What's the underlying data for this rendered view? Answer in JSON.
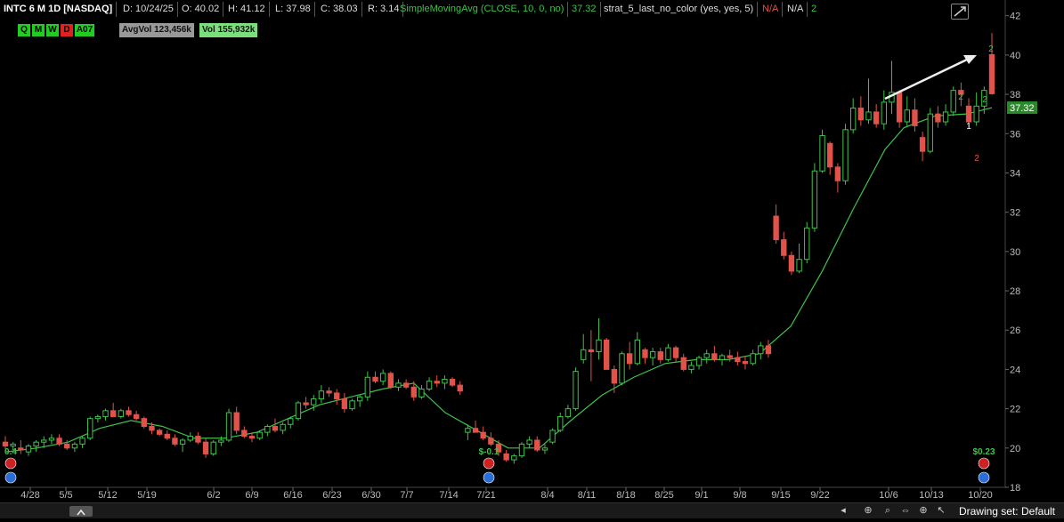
{
  "header": {
    "symbol": "INTC 6 M 1D [NASDAQ]",
    "date": "D: 10/24/25",
    "open": "O: 40.02",
    "high": "H: 41.12",
    "low": "L: 37.98",
    "close": "C: 38.03",
    "range": "R: 3.14",
    "study": "SimpleMovingAvg (CLOSE, 10, 0, no)",
    "study_value": "37.32",
    "strat": "strat_5_last_no_color (yes, yes, 5)",
    "na1": "N/A",
    "na2": "N/A",
    "count": "2"
  },
  "flags": [
    "Q",
    "M",
    "W",
    "D",
    "A07"
  ],
  "flag_colors": [
    "#22cc22",
    "#22cc22",
    "#22cc22",
    "#dd2222",
    "#22cc22"
  ],
  "avgvol": "AvgVol 123,456k",
  "vol": "Vol 155,932k",
  "price_tag": "37.32",
  "event_labels": [
    {
      "text": "$-0.1",
      "date": "7/21"
    },
    {
      "text": "$0.23",
      "date": "10/20"
    },
    {
      "text": "0.4",
      "date": "4/28"
    }
  ],
  "strat_marks": [
    {
      "text": "2",
      "color": "#3fc24a"
    },
    {
      "text": "2",
      "color": "#3fc24a"
    },
    {
      "text": "2",
      "color": "#3fc24a"
    },
    {
      "text": "1",
      "color": "#ffffff"
    },
    {
      "text": "2",
      "color": "#e0524a"
    }
  ],
  "footer": {
    "drawing_set": "Drawing set: Default"
  },
  "colors": {
    "up": "#3fc24a",
    "down": "#e0524a",
    "sma": "#3fc24a",
    "axis": "#bbbbbb"
  },
  "chart_data": {
    "type": "candlestick",
    "title": "INTC 6 M 1D [NASDAQ]",
    "x_tick_labels": [
      "4/28",
      "5/5",
      "5/12",
      "5/19",
      "6/2",
      "6/9",
      "6/16",
      "6/23",
      "6/30",
      "7/7",
      "7/14",
      "7/21",
      "8/4",
      "8/11",
      "8/18",
      "8/25",
      "9/1",
      "9/8",
      "9/15",
      "9/22",
      "10/6",
      "10/13",
      "10/20"
    ],
    "y_ticks": [
      18,
      20,
      22,
      24,
      26,
      28,
      30,
      32,
      34,
      36,
      38,
      40,
      42
    ],
    "ylim": [
      18,
      42.8
    ],
    "candles": [
      [
        20.3,
        20.6,
        19.9,
        20.1
      ],
      [
        20.1,
        20.3,
        19.9,
        20.2
      ],
      [
        20.0,
        20.4,
        19.7,
        19.9
      ],
      [
        19.8,
        20.2,
        19.6,
        20.1
      ],
      [
        20.1,
        20.4,
        19.8,
        20.3
      ],
      [
        20.3,
        20.6,
        20.0,
        20.4
      ],
      [
        20.4,
        20.7,
        20.2,
        20.5
      ],
      [
        20.5,
        20.7,
        20.1,
        20.2
      ],
      [
        20.2,
        20.4,
        19.9,
        20.0
      ],
      [
        20.0,
        20.3,
        19.8,
        20.2
      ],
      [
        20.2,
        20.6,
        20.0,
        20.5
      ],
      [
        20.5,
        21.6,
        20.4,
        21.5
      ],
      [
        21.5,
        21.7,
        21.3,
        21.6
      ],
      [
        21.6,
        22.0,
        21.4,
        21.9
      ],
      [
        21.9,
        22.3,
        21.7,
        21.6
      ],
      [
        21.6,
        22.0,
        21.5,
        21.9
      ],
      [
        21.9,
        22.1,
        21.6,
        21.7
      ],
      [
        21.7,
        21.9,
        21.4,
        21.5
      ],
      [
        21.5,
        21.6,
        21.0,
        21.1
      ],
      [
        21.1,
        21.3,
        20.7,
        20.9
      ],
      [
        20.9,
        21.0,
        20.6,
        20.7
      ],
      [
        20.7,
        20.9,
        20.4,
        20.5
      ],
      [
        20.5,
        20.7,
        20.1,
        20.2
      ],
      [
        20.2,
        20.5,
        19.8,
        20.4
      ],
      [
        20.4,
        20.8,
        20.3,
        20.6
      ],
      [
        20.6,
        20.8,
        20.2,
        20.3
      ],
      [
        20.3,
        20.5,
        19.5,
        19.7
      ],
      [
        19.7,
        20.4,
        19.6,
        20.3
      ],
      [
        20.3,
        20.6,
        20.1,
        20.4
      ],
      [
        20.4,
        22.0,
        20.3,
        21.8
      ],
      [
        21.8,
        22.1,
        20.7,
        20.9
      ],
      [
        20.9,
        21.1,
        20.5,
        20.6
      ],
      [
        20.6,
        20.8,
        20.3,
        20.5
      ],
      [
        20.5,
        20.9,
        20.4,
        20.8
      ],
      [
        20.8,
        21.2,
        20.6,
        21.1
      ],
      [
        21.1,
        21.5,
        20.8,
        20.9
      ],
      [
        20.9,
        21.3,
        20.7,
        21.2
      ],
      [
        21.2,
        21.6,
        21.0,
        21.5
      ],
      [
        21.5,
        22.4,
        21.4,
        22.3
      ],
      [
        22.3,
        22.6,
        22.0,
        22.2
      ],
      [
        22.2,
        22.7,
        21.9,
        22.5
      ],
      [
        22.5,
        23.2,
        22.3,
        22.9
      ],
      [
        22.9,
        23.1,
        22.6,
        22.8
      ],
      [
        22.8,
        23.0,
        22.2,
        22.5
      ],
      [
        22.5,
        22.8,
        21.8,
        22.0
      ],
      [
        22.0,
        22.5,
        21.9,
        22.4
      ],
      [
        22.4,
        22.7,
        22.1,
        22.6
      ],
      [
        22.6,
        23.9,
        22.4,
        23.6
      ],
      [
        23.6,
        23.9,
        23.3,
        23.4
      ],
      [
        23.4,
        24.0,
        23.2,
        23.8
      ],
      [
        23.8,
        23.9,
        23.0,
        23.1
      ],
      [
        23.1,
        23.5,
        22.9,
        23.3
      ],
      [
        23.3,
        23.5,
        23.0,
        23.1
      ],
      [
        23.1,
        23.4,
        22.4,
        22.6
      ],
      [
        22.6,
        23.2,
        22.5,
        23.0
      ],
      [
        23.0,
        23.6,
        22.9,
        23.4
      ],
      [
        23.4,
        23.7,
        23.1,
        23.3
      ],
      [
        23.3,
        23.7,
        23.0,
        23.5
      ],
      [
        23.5,
        23.6,
        23.1,
        23.2
      ],
      [
        23.2,
        23.4,
        22.7,
        22.9
      ],
      [
        20.8,
        21.2,
        20.4,
        21.0
      ],
      [
        21.0,
        21.4,
        20.9,
        20.8
      ],
      [
        20.8,
        21.1,
        20.4,
        20.5
      ],
      [
        20.5,
        20.8,
        20.1,
        20.2
      ],
      [
        20.2,
        20.4,
        19.6,
        19.8
      ],
      [
        19.7,
        19.9,
        19.3,
        19.4
      ],
      [
        19.4,
        19.7,
        19.2,
        19.6
      ],
      [
        19.6,
        20.3,
        19.5,
        20.2
      ],
      [
        20.2,
        20.6,
        20.0,
        20.4
      ],
      [
        20.4,
        20.6,
        19.8,
        19.9
      ],
      [
        19.9,
        20.2,
        19.7,
        20.0
      ],
      [
        20.3,
        21.0,
        20.2,
        20.9
      ],
      [
        20.9,
        21.8,
        20.8,
        21.6
      ],
      [
        21.6,
        22.2,
        21.5,
        22.0
      ],
      [
        22.0,
        24.1,
        21.9,
        23.9
      ],
      [
        24.5,
        25.8,
        24.3,
        25.0
      ],
      [
        25.0,
        26.0,
        23.4,
        24.9
      ],
      [
        24.9,
        26.6,
        24.5,
        25.5
      ],
      [
        25.5,
        25.6,
        24.0,
        24.0
      ],
      [
        24.0,
        24.2,
        22.8,
        23.3
      ],
      [
        23.3,
        24.9,
        23.2,
        24.8
      ],
      [
        24.8,
        25.4,
        24.0,
        24.3
      ],
      [
        24.3,
        25.9,
        24.2,
        25.5
      ],
      [
        25.0,
        25.1,
        24.3,
        24.6
      ],
      [
        24.6,
        25.1,
        24.2,
        24.9
      ],
      [
        24.9,
        25.1,
        24.3,
        24.5
      ],
      [
        24.5,
        25.3,
        24.4,
        25.1
      ],
      [
        25.1,
        25.2,
        24.4,
        24.6
      ],
      [
        24.6,
        24.8,
        23.9,
        24.0
      ],
      [
        24.0,
        24.4,
        23.8,
        24.2
      ],
      [
        24.2,
        24.7,
        24.0,
        24.6
      ],
      [
        24.6,
        25.0,
        24.3,
        24.8
      ],
      [
        24.8,
        25.2,
        24.4,
        24.5
      ],
      [
        24.5,
        24.8,
        24.2,
        24.7
      ],
      [
        24.7,
        25.0,
        24.4,
        24.6
      ],
      [
        24.6,
        24.9,
        24.2,
        24.4
      ],
      [
        24.4,
        24.7,
        24.0,
        24.3
      ],
      [
        24.3,
        25.0,
        24.2,
        24.8
      ],
      [
        24.8,
        25.4,
        24.5,
        25.2
      ],
      [
        25.2,
        25.5,
        24.6,
        24.8
      ],
      [
        31.8,
        32.4,
        30.4,
        30.6
      ],
      [
        30.6,
        31.0,
        29.6,
        29.8
      ],
      [
        29.8,
        30.0,
        28.8,
        29.0
      ],
      [
        29.0,
        30.4,
        28.9,
        29.6
      ],
      [
        29.6,
        31.5,
        29.4,
        31.2
      ],
      [
        31.2,
        34.5,
        31.0,
        34.1
      ],
      [
        34.1,
        36.2,
        34.0,
        35.9
      ],
      [
        35.5,
        35.6,
        33.9,
        34.3
      ],
      [
        34.3,
        34.5,
        33.0,
        33.6
      ],
      [
        33.6,
        36.5,
        33.4,
        36.2
      ],
      [
        36.2,
        37.8,
        36.0,
        37.3
      ],
      [
        37.3,
        37.9,
        36.4,
        36.7
      ],
      [
        36.7,
        38.8,
        36.5,
        37.1
      ],
      [
        37.1,
        37.5,
        36.3,
        36.5
      ],
      [
        36.5,
        38.2,
        36.2,
        37.6
      ],
      [
        37.6,
        39.7,
        37.0,
        38.1
      ],
      [
        38.1,
        38.2,
        36.3,
        36.6
      ],
      [
        36.6,
        37.9,
        36.4,
        37.2
      ],
      [
        37.2,
        37.8,
        36.1,
        36.4
      ],
      [
        35.8,
        36.1,
        34.6,
        35.1
      ],
      [
        35.1,
        37.3,
        35.0,
        37.0
      ],
      [
        37.0,
        37.4,
        36.3,
        36.6
      ],
      [
        36.6,
        37.5,
        36.4,
        37.1
      ],
      [
        37.1,
        38.4,
        36.9,
        38.2
      ],
      [
        38.2,
        38.6,
        37.4,
        38.0
      ],
      [
        37.4,
        37.8,
        36.3,
        36.6
      ],
      [
        36.6,
        38.1,
        36.4,
        37.4
      ],
      [
        37.4,
        38.4,
        37.0,
        38.2
      ],
      [
        40.02,
        41.12,
        37.98,
        38.03
      ]
    ],
    "sma_10": [
      [
        0,
        19.8
      ],
      [
        5,
        20.0
      ],
      [
        10,
        20.3
      ],
      [
        15,
        21.0
      ],
      [
        20,
        21.4
      ],
      [
        25,
        21.1
      ],
      [
        30,
        20.5
      ],
      [
        35,
        20.5
      ],
      [
        40,
        20.8
      ],
      [
        45,
        21.5
      ],
      [
        50,
        22.2
      ],
      [
        55,
        22.6
      ],
      [
        60,
        23.0
      ],
      [
        65,
        23.3
      ],
      [
        70,
        21.8
      ],
      [
        75,
        20.9
      ],
      [
        80,
        20.0
      ],
      [
        85,
        20.0
      ],
      [
        90,
        21.4
      ],
      [
        95,
        22.7
      ],
      [
        100,
        23.6
      ],
      [
        105,
        24.3
      ],
      [
        110,
        24.5
      ],
      [
        115,
        24.5
      ],
      [
        120,
        24.8
      ],
      [
        125,
        26.2
      ],
      [
        130,
        29.0
      ],
      [
        135,
        32.2
      ],
      [
        140,
        35.2
      ],
      [
        143,
        36.3
      ],
      [
        148,
        36.9
      ],
      [
        153,
        37.0
      ],
      [
        157,
        37.32
      ]
    ]
  }
}
